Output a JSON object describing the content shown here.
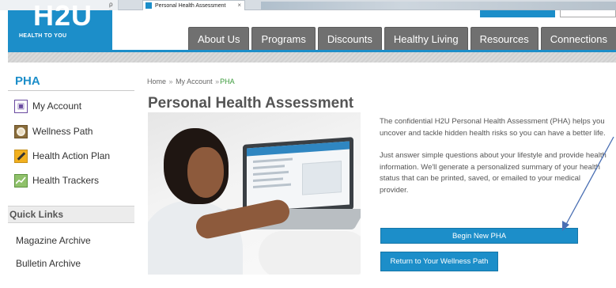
{
  "browser": {
    "tab_title": "Personal Health Assessment",
    "tab_close": "×",
    "nav_glyphs": "ρ ▾ ■ ℃"
  },
  "site": {
    "logo_text": "H2U",
    "logo_tagline": "HEALTH TO YOU",
    "brand_color": "#1c8ec9",
    "nav_tabs": [
      "About Us",
      "Programs",
      "Discounts",
      "Healthy Living",
      "Resources",
      "Connections"
    ]
  },
  "sidebar": {
    "title": "PHA",
    "items": [
      {
        "label": "My Account",
        "icon": "account-icon"
      },
      {
        "label": "Wellness Path",
        "icon": "wellness-path-icon"
      },
      {
        "label": "Health Action Plan",
        "icon": "action-plan-icon"
      },
      {
        "label": "Health Trackers",
        "icon": "trackers-icon"
      }
    ],
    "quick_links_title": "Quick Links",
    "quick_links": [
      "Magazine Archive",
      "Bulletin Archive"
    ]
  },
  "breadcrumb": {
    "home": "Home",
    "account": "My Account",
    "current": "PHA",
    "sep": "»"
  },
  "main": {
    "title": "Personal Health Assessment",
    "paragraph1": "The confidential H2U Personal Health Assessment (PHA) helps you uncover and tackle hidden health risks so you can have a better life.",
    "paragraph2": "Just answer simple questions about your lifestyle and provide health information. We'll generate a personalized summary of your health status that can be printed, saved, or emailed to your medical provider.",
    "begin_button": "Begin New PHA",
    "return_button": "Return to Your Wellness Path"
  }
}
